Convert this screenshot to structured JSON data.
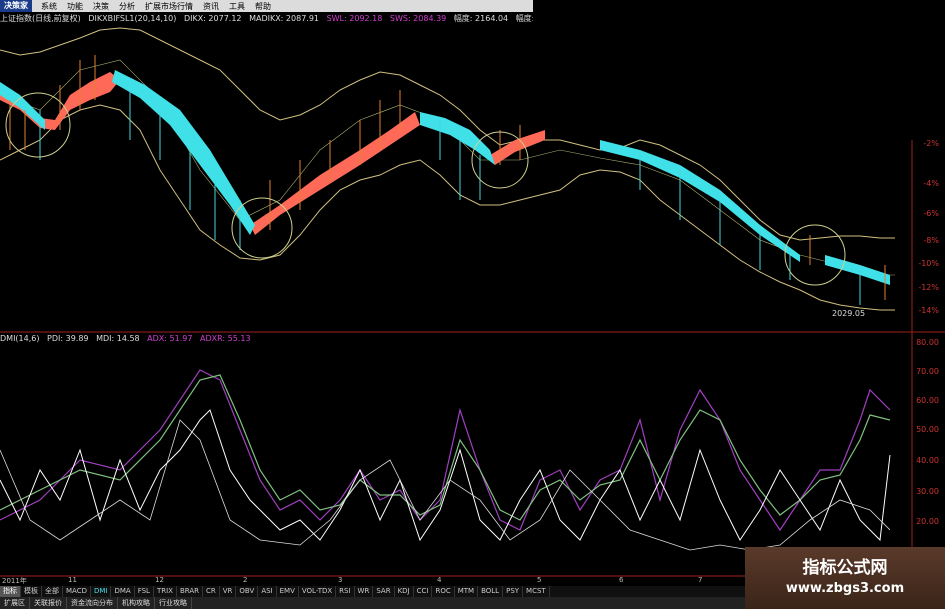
{
  "menu": {
    "logo": "决策家",
    "items": [
      "系统",
      "功能",
      "决策",
      "分析",
      "扩展市场行情",
      "资讯",
      "工具",
      "帮助"
    ]
  },
  "info": {
    "title": "上证指数(日线,前复权)",
    "indicator": "DIKXBIFSL1(20,14,10)",
    "dikx": "DIKX: 2077.12",
    "madikx": "MADIKX: 2087.91",
    "swl": "SWL: 2092.18",
    "sws": "SWS: 2084.39",
    "fuduo": "幅度: 2164.04",
    "fukong": "幅度:"
  },
  "price_axis": [
    "-2%",
    "-4%",
    "-6%",
    "-8%",
    "-10%",
    "-12%",
    "-14%"
  ],
  "price_label": "2029.05",
  "dmi": {
    "title": "DMI(14,6)",
    "pdi": "PDI: 39.89",
    "mdi": "MDI: 14.58",
    "adx": "ADX: 51.97",
    "adxr": "ADXR: 55.13"
  },
  "dmi_axis": [
    "80.00",
    "70.00",
    "60.00",
    "50.00",
    "40.00",
    "30.00",
    "20.00"
  ],
  "dates": [
    "2011年",
    "11",
    "12",
    "2",
    "3",
    "4",
    "5",
    "6",
    "7"
  ],
  "tabs": [
    "指标",
    "模板",
    "全部",
    "MACD",
    "DMI",
    "DMA",
    "FSL",
    "TRIX",
    "BRAR",
    "CR",
    "VR",
    "OBV",
    "ASI",
    "EMV",
    "VOL-TDX",
    "RSI",
    "WR",
    "SAR",
    "KDJ",
    "CCI",
    "ROC",
    "MTM",
    "BOLL",
    "PSY",
    "MCST"
  ],
  "bottom": [
    "扩展区",
    "关联报价",
    "资金流向分布",
    "机构攻略",
    "行业攻略"
  ],
  "watermark": {
    "line1": "指标公式网",
    "line2": "www.zbgs3.com"
  },
  "colors": {
    "up": "#e0a040",
    "down": "#30d0d0",
    "pdi": "#a040c0",
    "mdi": "#80c080",
    "adx": "#ffffff",
    "axis": "#c33333",
    "band_up": "#ff6050",
    "band_down": "#40e0e8"
  }
}
